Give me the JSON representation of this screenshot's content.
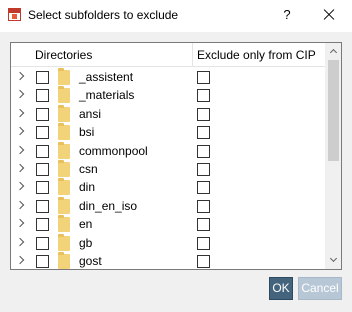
{
  "window": {
    "title": "Select subfolders to exclude",
    "help_label": "?"
  },
  "table": {
    "columns": [
      "Directories",
      "Exclude only from CIP"
    ],
    "rows": [
      {
        "name": "_assistent",
        "excluded": false,
        "cip_only": false
      },
      {
        "name": "_materials",
        "excluded": false,
        "cip_only": false
      },
      {
        "name": "ansi",
        "excluded": false,
        "cip_only": false
      },
      {
        "name": "bsi",
        "excluded": false,
        "cip_only": false
      },
      {
        "name": "commonpool",
        "excluded": false,
        "cip_only": false
      },
      {
        "name": "csn",
        "excluded": false,
        "cip_only": false
      },
      {
        "name": "din",
        "excluded": false,
        "cip_only": false
      },
      {
        "name": "din_en_iso",
        "excluded": false,
        "cip_only": false
      },
      {
        "name": "en",
        "excluded": false,
        "cip_only": false
      },
      {
        "name": "gb",
        "excluded": false,
        "cip_only": false
      },
      {
        "name": "gost",
        "excluded": false,
        "cip_only": false
      }
    ]
  },
  "buttons": {
    "ok_label": "OK",
    "cancel_label": "Cancel"
  },
  "colors": {
    "ok_bg": "#44637d",
    "cancel_bg": "#b8c7d6",
    "folder": "#f3d37a"
  },
  "icons": {
    "app": "app-icon",
    "help": "help-icon",
    "close": "close-icon",
    "expand": "chevron-right-icon",
    "folder": "folder-icon"
  }
}
